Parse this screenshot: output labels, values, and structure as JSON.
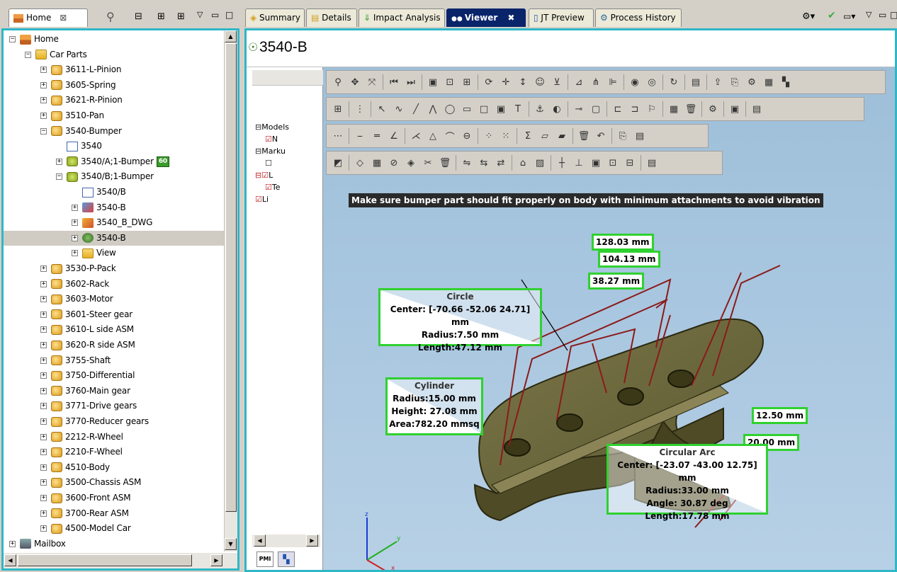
{
  "left_tab": {
    "label": "Home",
    "close": "⊠"
  },
  "tree": [
    {
      "label": "Home",
      "indent": 0,
      "pm": "−",
      "icon": "home"
    },
    {
      "label": "Car Parts",
      "indent": 1,
      "pm": "−",
      "icon": "folder"
    },
    {
      "label": "3611-L-Pinion",
      "indent": 2,
      "pm": "+",
      "icon": "part"
    },
    {
      "label": "3605-Spring",
      "indent": 2,
      "pm": "+",
      "icon": "part"
    },
    {
      "label": "3621-R-Pinion",
      "indent": 2,
      "pm": "+",
      "icon": "part"
    },
    {
      "label": "3510-Pan",
      "indent": 2,
      "pm": "+",
      "icon": "part"
    },
    {
      "label": "3540-Bumper",
      "indent": 2,
      "pm": "−",
      "icon": "part"
    },
    {
      "label": "3540",
      "indent": 3,
      "pm": "",
      "icon": "doc"
    },
    {
      "label": "3540/A;1-Bumper",
      "indent": 3,
      "pm": "+",
      "icon": "rev",
      "badge": "60"
    },
    {
      "label": "3540/B;1-Bumper",
      "indent": 3,
      "pm": "−",
      "icon": "rev"
    },
    {
      "label": "3540/B",
      "indent": 4,
      "pm": "",
      "icon": "doc"
    },
    {
      "label": "3540-B",
      "indent": 4,
      "pm": "+",
      "icon": "model"
    },
    {
      "label": "3540_B_DWG",
      "indent": 4,
      "pm": "+",
      "icon": "dwg"
    },
    {
      "label": "3540-B",
      "indent": 4,
      "pm": "+",
      "icon": "jt",
      "selected": true
    },
    {
      "label": "View",
      "indent": 4,
      "pm": "+",
      "icon": "folder"
    },
    {
      "label": "3530-P-Pack",
      "indent": 2,
      "pm": "+",
      "icon": "part"
    },
    {
      "label": "3602-Rack",
      "indent": 2,
      "pm": "+",
      "icon": "part"
    },
    {
      "label": "3603-Motor",
      "indent": 2,
      "pm": "+",
      "icon": "part"
    },
    {
      "label": "3601-Steer gear",
      "indent": 2,
      "pm": "+",
      "icon": "part"
    },
    {
      "label": "3610-L side ASM",
      "indent": 2,
      "pm": "+",
      "icon": "part"
    },
    {
      "label": "3620-R side ASM",
      "indent": 2,
      "pm": "+",
      "icon": "part"
    },
    {
      "label": "3755-Shaft",
      "indent": 2,
      "pm": "+",
      "icon": "part"
    },
    {
      "label": "3750-Differential",
      "indent": 2,
      "pm": "+",
      "icon": "part"
    },
    {
      "label": "3760-Main gear",
      "indent": 2,
      "pm": "+",
      "icon": "part"
    },
    {
      "label": "3771-Drive gears",
      "indent": 2,
      "pm": "+",
      "icon": "part"
    },
    {
      "label": "3770-Reducer gears",
      "indent": 2,
      "pm": "+",
      "icon": "part"
    },
    {
      "label": "2212-R-Wheel",
      "indent": 2,
      "pm": "+",
      "icon": "part"
    },
    {
      "label": "2210-F-Wheel",
      "indent": 2,
      "pm": "+",
      "icon": "part"
    },
    {
      "label": "4510-Body",
      "indent": 2,
      "pm": "+",
      "icon": "part"
    },
    {
      "label": "3500-Chassis ASM",
      "indent": 2,
      "pm": "+",
      "icon": "part"
    },
    {
      "label": "3600-Front ASM",
      "indent": 2,
      "pm": "+",
      "icon": "part"
    },
    {
      "label": "3700-Rear ASM",
      "indent": 2,
      "pm": "+",
      "icon": "part"
    },
    {
      "label": "4500-Model Car",
      "indent": 2,
      "pm": "+",
      "icon": "part"
    },
    {
      "label": "Mailbox",
      "indent": 0,
      "pm": "+",
      "icon": "mail"
    }
  ],
  "right_tabs": [
    "Summary",
    "Details",
    "Impact Analysis",
    "Viewer",
    "JT Preview",
    "Process History"
  ],
  "viewer_title": "3540-B",
  "markup_tree": [
    {
      "label": "Models",
      "prefix": "⊟"
    },
    {
      "label": "N",
      "prefix": "☑"
    },
    {
      "label": "Marku",
      "prefix": "⊟"
    },
    {
      "label": "",
      "prefix": "☐"
    },
    {
      "label": "L",
      "prefix": "⊟☑"
    },
    {
      "label": "Te",
      "prefix": "☑"
    },
    {
      "label": "Li",
      "prefix": "☑"
    }
  ],
  "annotation_note": "Make sure bumper part should fit properly on body with minimum attachments to avoid vibration",
  "dims": {
    "d1": "128.03 mm",
    "d2": "104.13 mm",
    "d3": "38.27 mm",
    "d4": "12.50 mm",
    "d5": "20.00 mm"
  },
  "circle": {
    "title": "Circle",
    "center": "Center: [-70.66 -52.06 24.71] mm",
    "radius": "Radius:7.50 mm",
    "length": "Length:47.12 mm"
  },
  "cylinder": {
    "title": "Cylinder",
    "radius": "Radius:15.00 mm",
    "height": "Height: 27.08 mm",
    "area": "Area:782.20 mmsq"
  },
  "arc": {
    "title": "Circular Arc",
    "center": "Center: [-23.07 -43.00 12.75] mm",
    "radius": "Radius:33.00 mm",
    "angle": "Angle: 30.87 deg",
    "length": "Length:17.78 mm"
  },
  "axes": {
    "z": "z",
    "y": "y",
    "x": "x"
  },
  "colors": {
    "accent": "#2eb7c7",
    "measure": "#2fd12f",
    "dimline": "#8b1a1a",
    "part": "#6f6a3e"
  },
  "bottom_tabs": [
    "PMI",
    "structure-icon"
  ]
}
